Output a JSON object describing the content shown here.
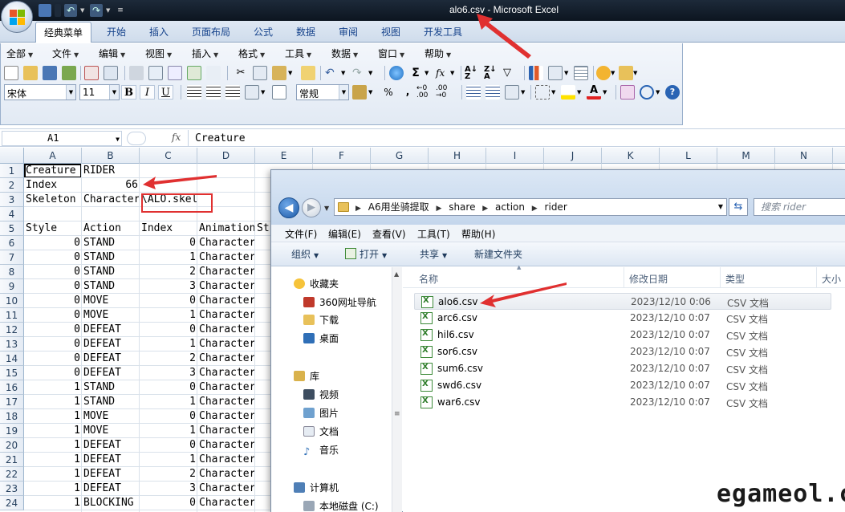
{
  "window": {
    "title": "alo6.csv - Microsoft Excel"
  },
  "ribbon_tabs": [
    "经典菜单",
    "开始",
    "插入",
    "页面布局",
    "公式",
    "数据",
    "审阅",
    "视图",
    "开发工具"
  ],
  "classic_menu": [
    "全部",
    "文件",
    "编辑",
    "视图",
    "插入",
    "格式",
    "工具",
    "数据",
    "窗口",
    "帮助"
  ],
  "toolbar": {
    "font_name": "宋体",
    "font_size": "11",
    "bold": "B",
    "italic": "I",
    "underline": "U",
    "number_format": "常规",
    "percent": "%",
    "comma": ","
  },
  "formula_bar": {
    "name_box": "A1",
    "fx": "fx",
    "value": "Creature"
  },
  "columns": [
    "A",
    "B",
    "C",
    "D",
    "E",
    "F",
    "G",
    "H",
    "I",
    "J",
    "K",
    "L",
    "M",
    "N"
  ],
  "rows": [
    "1",
    "2",
    "3",
    "4",
    "5",
    "6",
    "7",
    "8",
    "9",
    "10",
    "11",
    "12",
    "13",
    "14",
    "15",
    "16",
    "17",
    "18",
    "19",
    "20",
    "21",
    "22",
    "23",
    "24"
  ],
  "cells": {
    "r1": {
      "a": "Creature",
      "b": "RIDER"
    },
    "r2": {
      "a": "Index",
      "b": "66"
    },
    "r3": {
      "a": "Skeleton",
      "b": "Character",
      "c": "\\ALO.skel"
    },
    "r5": {
      "a": "Style",
      "b": "Action",
      "c": "Index",
      "d": "Animation",
      "e": "St"
    },
    "data": [
      {
        "a": "0",
        "b": "STAND",
        "c": "0",
        "d": "Character"
      },
      {
        "a": "0",
        "b": "STAND",
        "c": "1",
        "d": "Character"
      },
      {
        "a": "0",
        "b": "STAND",
        "c": "2",
        "d": "Character"
      },
      {
        "a": "0",
        "b": "STAND",
        "c": "3",
        "d": "Character"
      },
      {
        "a": "0",
        "b": "MOVE",
        "c": "0",
        "d": "Character"
      },
      {
        "a": "0",
        "b": "MOVE",
        "c": "1",
        "d": "Character"
      },
      {
        "a": "0",
        "b": "DEFEAT",
        "c": "0",
        "d": "Character"
      },
      {
        "a": "0",
        "b": "DEFEAT",
        "c": "1",
        "d": "Character"
      },
      {
        "a": "0",
        "b": "DEFEAT",
        "c": "2",
        "d": "Character"
      },
      {
        "a": "0",
        "b": "DEFEAT",
        "c": "3",
        "d": "Character"
      },
      {
        "a": "1",
        "b": "STAND",
        "c": "0",
        "d": "Character"
      },
      {
        "a": "1",
        "b": "STAND",
        "c": "1",
        "d": "Character"
      },
      {
        "a": "1",
        "b": "MOVE",
        "c": "0",
        "d": "Character"
      },
      {
        "a": "1",
        "b": "MOVE",
        "c": "1",
        "d": "Character"
      },
      {
        "a": "1",
        "b": "DEFEAT",
        "c": "0",
        "d": "Character"
      },
      {
        "a": "1",
        "b": "DEFEAT",
        "c": "1",
        "d": "Character"
      },
      {
        "a": "1",
        "b": "DEFEAT",
        "c": "2",
        "d": "Character"
      },
      {
        "a": "1",
        "b": "DEFEAT",
        "c": "3",
        "d": "Character"
      },
      {
        "a": "1",
        "b": "BLOCKING",
        "c": "0",
        "d": "Character"
      }
    ]
  },
  "explorer": {
    "breadcrumb": [
      "A6用坐骑提取",
      "share",
      "action",
      "rider"
    ],
    "search_placeholder": "搜索 rider",
    "menu": [
      "文件(F)",
      "编辑(E)",
      "查看(V)",
      "工具(T)",
      "帮助(H)"
    ],
    "commands": [
      "组织",
      "打开",
      "共享",
      "新建文件夹"
    ],
    "nav": {
      "favorites": "收藏夹",
      "fav_items": [
        "360网址导航",
        "下载",
        "桌面"
      ],
      "libraries": "库",
      "lib_items": [
        "视频",
        "图片",
        "文档",
        "音乐"
      ],
      "computer": "计算机",
      "drive": "本地磁盘 (C:)"
    },
    "columns": {
      "name": "名称",
      "date": "修改日期",
      "type": "类型",
      "size": "大小"
    },
    "files": [
      {
        "name": "alo6.csv",
        "date": "2023/12/10 0:06",
        "type": "CSV 文档"
      },
      {
        "name": "arc6.csv",
        "date": "2023/12/10 0:07",
        "type": "CSV 文档"
      },
      {
        "name": "hil6.csv",
        "date": "2023/12/10 0:07",
        "type": "CSV 文档"
      },
      {
        "name": "sor6.csv",
        "date": "2023/12/10 0:07",
        "type": "CSV 文档"
      },
      {
        "name": "sum6.csv",
        "date": "2023/12/10 0:07",
        "type": "CSV 文档"
      },
      {
        "name": "swd6.csv",
        "date": "2023/12/10 0:07",
        "type": "CSV 文档"
      },
      {
        "name": "war6.csv",
        "date": "2023/12/10 0:07",
        "type": "CSV 文档"
      }
    ]
  },
  "watermark": "egameol.cn",
  "colors": {
    "annotation": "#e03030",
    "excel_green": "#2f7d2b",
    "ribbon_text": "#15428b"
  }
}
